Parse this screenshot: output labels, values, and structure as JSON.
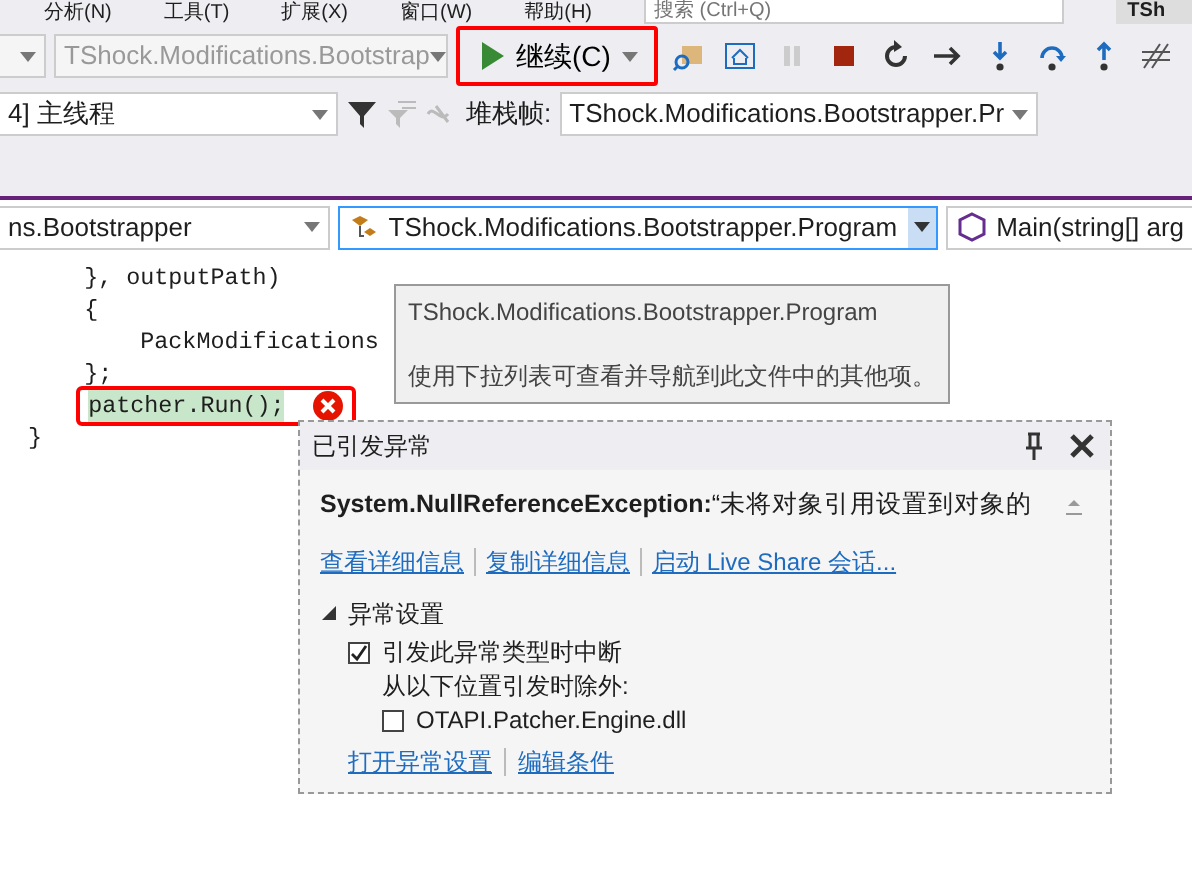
{
  "menu": [
    {
      "label": "分析(N)"
    },
    {
      "label": "工具(T)"
    },
    {
      "label": "扩展(X)"
    },
    {
      "label": "窗口(W)"
    },
    {
      "label": "帮助(H)"
    }
  ],
  "search": {
    "placeholder": "搜索 (Ctrl+Q)"
  },
  "title_fragment": "TSh",
  "toolbar": {
    "startup_project": "TShock.Modifications.Bootstrap",
    "continue_button": {
      "label": "继续(C)",
      "highlighted": true
    }
  },
  "thread_bar": {
    "thread": "4] 主线程",
    "stack_frame_label": "堆栈帧:",
    "stack_frame": "TShock.Modifications.Bootstrapper.Pr"
  },
  "nav_bar": {
    "project": "ns.Bootstrapper",
    "type": "TShock.Modifications.Bootstrapper.Program",
    "member": "Main(string[] arg"
  },
  "code_lines": [
    {
      "text": "      }, outputPath)",
      "current": false
    },
    {
      "text": "      {",
      "current": false
    },
    {
      "text": "          PackModifications",
      "current": false
    },
    {
      "text": "      };",
      "current": false
    },
    {
      "text": "      patcher.Run();",
      "current": true
    },
    {
      "text": "  }",
      "current": false
    }
  ],
  "tooltip": {
    "title": "TShock.Modifications.Bootstrapper.Program",
    "text": "使用下拉列表可查看并导航到此文件中的其他项。"
  },
  "exception": {
    "title": "已引发异常",
    "message": "**System.NullReferenceException:**“未将对象引用设置到对象的",
    "links": [
      "查看详细信息",
      "复制详细信息",
      "启动 Live Share 会话..."
    ],
    "settings": {
      "heading": "异常设置",
      "expanded": true,
      "break_option": {
        "label": "引发此异常类型时中断",
        "checked": true
      },
      "except_label": "从以下位置引发时除外:",
      "modules": [
        {
          "label": "OTAPI.Patcher.Engine.dll",
          "checked": false
        }
      ]
    },
    "footer_links": [
      "打开异常设置",
      "编辑条件"
    ]
  }
}
